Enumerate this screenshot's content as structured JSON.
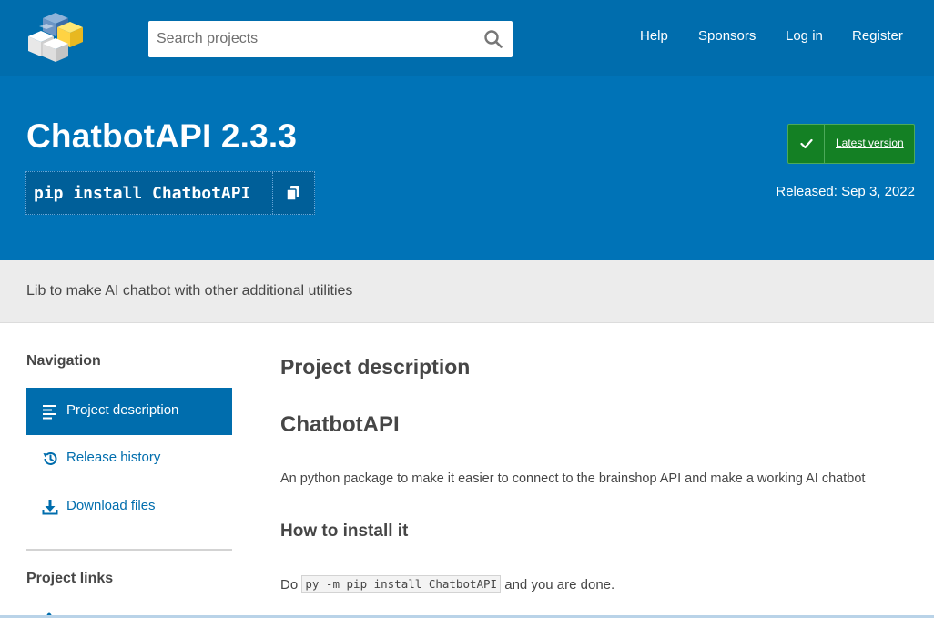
{
  "header": {
    "logo_icon": "pypi-cubes-logo",
    "search": {
      "placeholder": "Search projects",
      "value": ""
    },
    "nav": [
      {
        "label": "Help"
      },
      {
        "label": "Sponsors"
      },
      {
        "label": "Log in"
      },
      {
        "label": "Register"
      }
    ]
  },
  "package": {
    "title": "ChatbotAPI 2.3.3",
    "pip_command": "pip install ChatbotAPI",
    "latest_label": "Latest version",
    "released": "Released: Sep 3, 2022",
    "summary": "Lib to make AI chatbot with other additional utilities"
  },
  "sidebar": {
    "navigation_heading": "Navigation",
    "items": [
      {
        "label": "Project description",
        "icon": "align-left-icon",
        "active": true
      },
      {
        "label": "Release history",
        "icon": "history-icon",
        "active": false
      },
      {
        "label": "Download files",
        "icon": "download-icon",
        "active": false
      }
    ],
    "links_heading": "Project links"
  },
  "main": {
    "section_heading": "Project description",
    "readme_title": "ChatbotAPI",
    "intro": "An python package to make it easier to connect to the brainshop API and make a working AI chatbot",
    "install_heading": "How to install it",
    "install_prefix": "Do",
    "install_code": "py -m pip install ChatbotAPI",
    "install_suffix": "and you are done."
  },
  "colors": {
    "header_bg": "#006dad",
    "hero_bg": "#0073b7",
    "latest_green": "#148024",
    "summary_bg": "#ececec",
    "link_blue": "#006dad"
  }
}
